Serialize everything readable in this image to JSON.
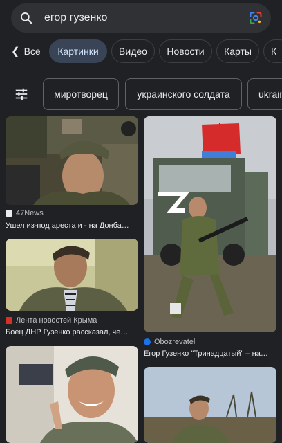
{
  "search": {
    "query": "егор гузенко"
  },
  "nav": {
    "back_label": "Все",
    "tabs": [
      {
        "label": "Картинки",
        "active": true
      },
      {
        "label": "Видео"
      },
      {
        "label": "Новости"
      },
      {
        "label": "Карты"
      },
      {
        "label": "К"
      }
    ]
  },
  "filters": {
    "chips": [
      "миротворец",
      "украинского солдата",
      "ukrain"
    ]
  },
  "results": {
    "left": [
      {
        "source": "47News",
        "caption": "Ушел из-под ареста и - на Донба…",
        "favicon_color": "#e8eaed"
      },
      {
        "source": "Лента новостей Крыма",
        "caption": "Боец ДНР Гузенко рассказал, че…",
        "favicon_color": "#d93025"
      },
      {
        "source": "",
        "caption": ""
      }
    ],
    "right": [
      {
        "source": "Obozrevatel",
        "caption": "Егор Гузенко \"Тринадцатый\" – на…",
        "favicon_color": "#1a73e8"
      },
      {
        "source": "",
        "caption": ""
      }
    ]
  },
  "colors": {
    "background": "#202124",
    "chip_border": "#5f6368",
    "active_tab": "#394457"
  }
}
